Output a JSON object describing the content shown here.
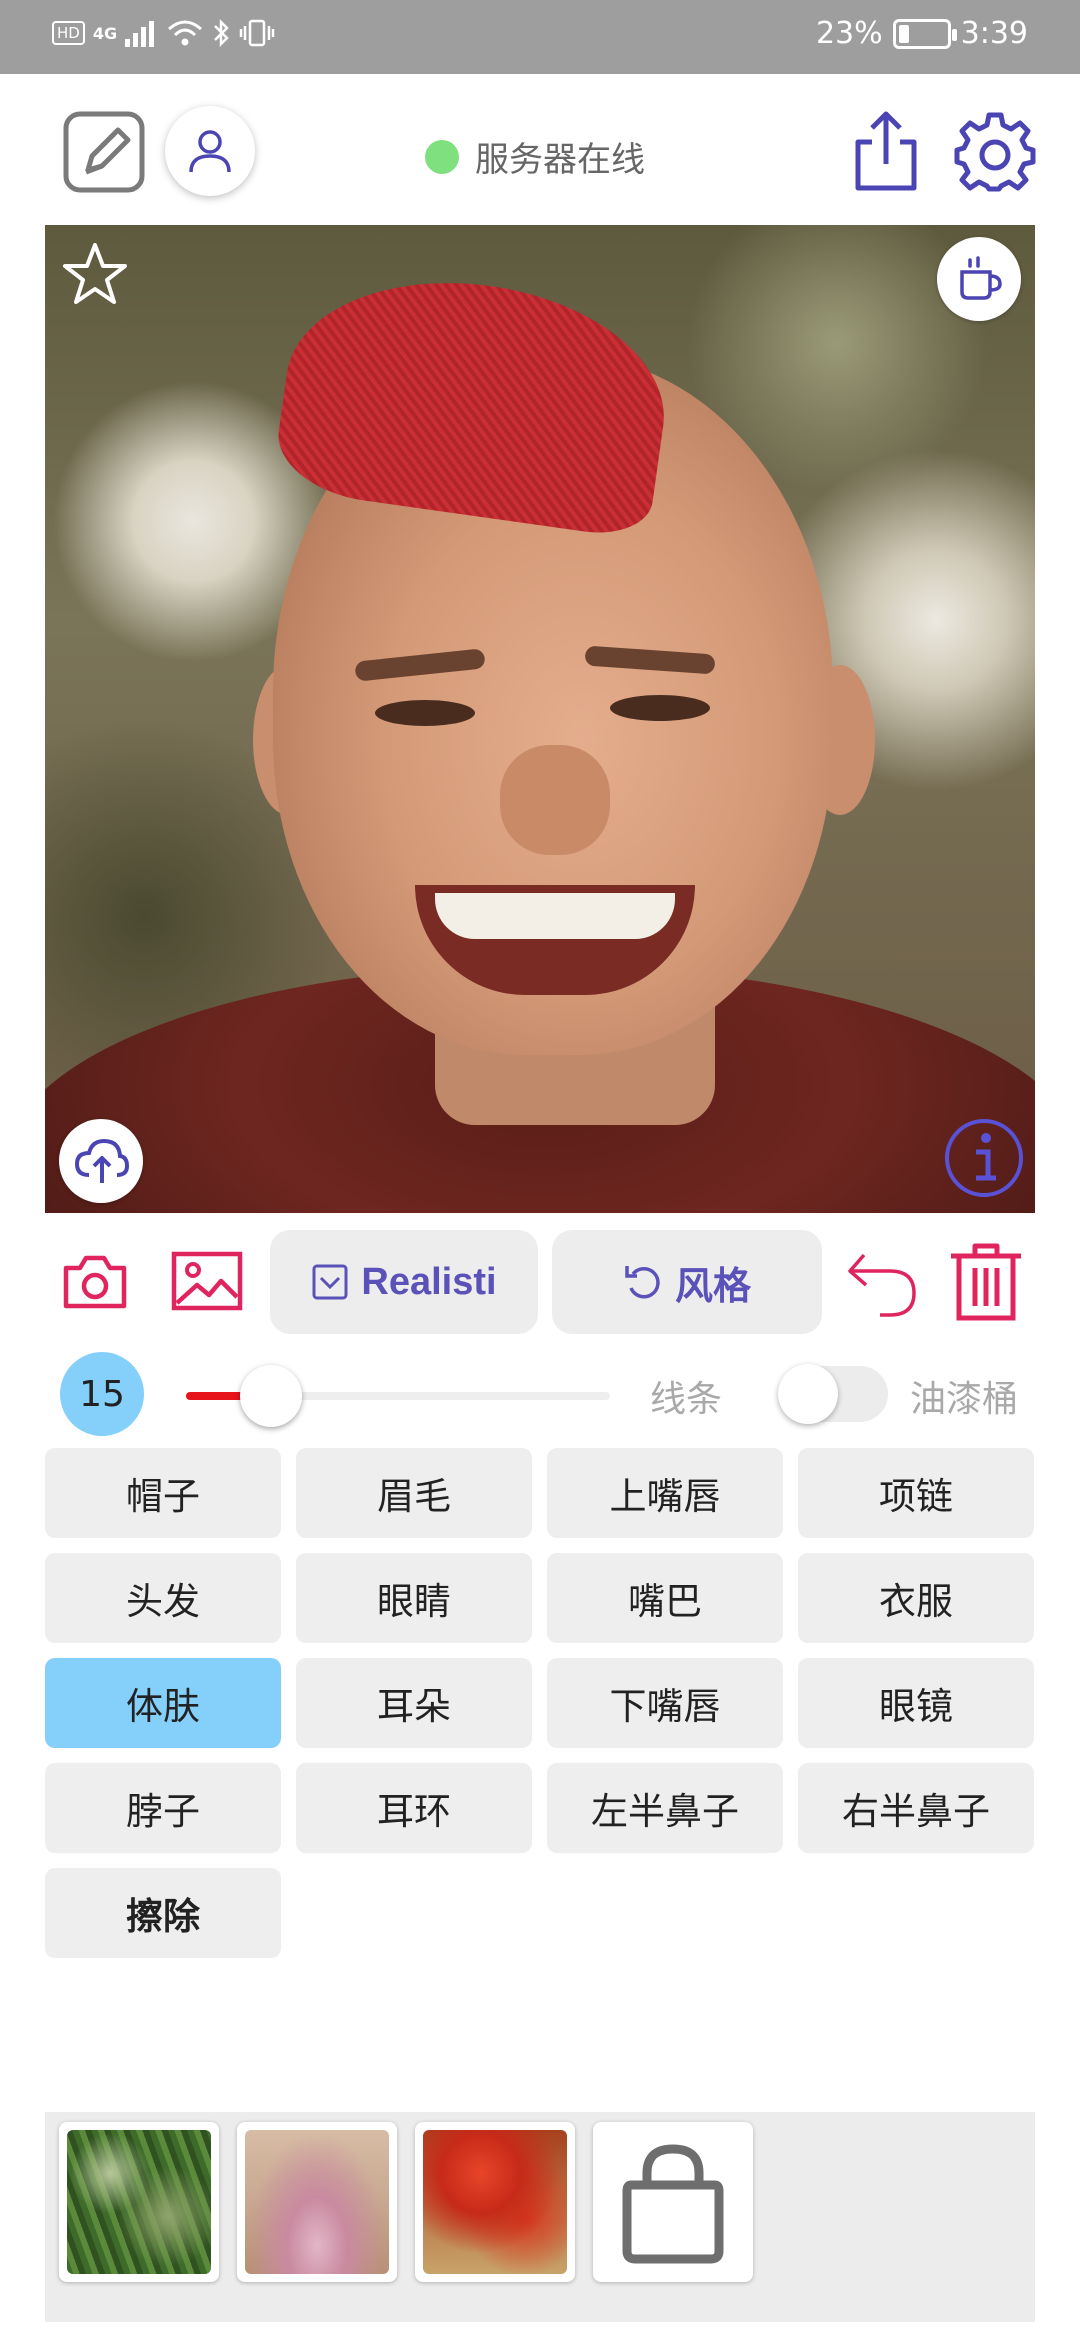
{
  "status_bar": {
    "hd_badge": "HD",
    "network": "4G",
    "battery_text": "23%",
    "battery_level": 0.23,
    "time": "3:39"
  },
  "toolbar": {
    "server_status": "服务器在线",
    "server_status_color": "#7ee07e",
    "icons": [
      "edit-icon",
      "user-icon",
      "share-icon",
      "settings-icon"
    ],
    "accent_color": "#4b45b3"
  },
  "canvas": {
    "overlay_icons": [
      "star-icon",
      "cup-icon",
      "upload-cloud-icon",
      "info-icon"
    ]
  },
  "actions": {
    "camera_icon": "camera-icon",
    "gallery_icon": "image-icon",
    "mode_label": "Realisti",
    "style_label": "风格",
    "undo_icon": "undo-icon",
    "delete_icon": "trash-icon",
    "accent_color": "#e0245e"
  },
  "brush": {
    "size": "15",
    "slider_level": 0.2,
    "line_label": "线条",
    "bucket_label": "油漆桶",
    "bucket_enabled": false
  },
  "parts": [
    {
      "label": "帽子"
    },
    {
      "label": "眉毛"
    },
    {
      "label": "上嘴唇"
    },
    {
      "label": "项链"
    },
    {
      "label": "头发"
    },
    {
      "label": "眼睛"
    },
    {
      "label": "嘴巴"
    },
    {
      "label": "衣服"
    },
    {
      "label": "体肤",
      "selected": true
    },
    {
      "label": "耳朵"
    },
    {
      "label": "下嘴唇"
    },
    {
      "label": "眼镜"
    },
    {
      "label": "脖子"
    },
    {
      "label": "耳环"
    },
    {
      "label": "左半鼻子"
    },
    {
      "label": "右半鼻子"
    },
    {
      "label": "擦除",
      "bold": true
    }
  ],
  "style_tray": {
    "items": [
      "style-thumbnail",
      "style-thumbnail",
      "style-thumbnail",
      "shop-bag-icon"
    ]
  }
}
